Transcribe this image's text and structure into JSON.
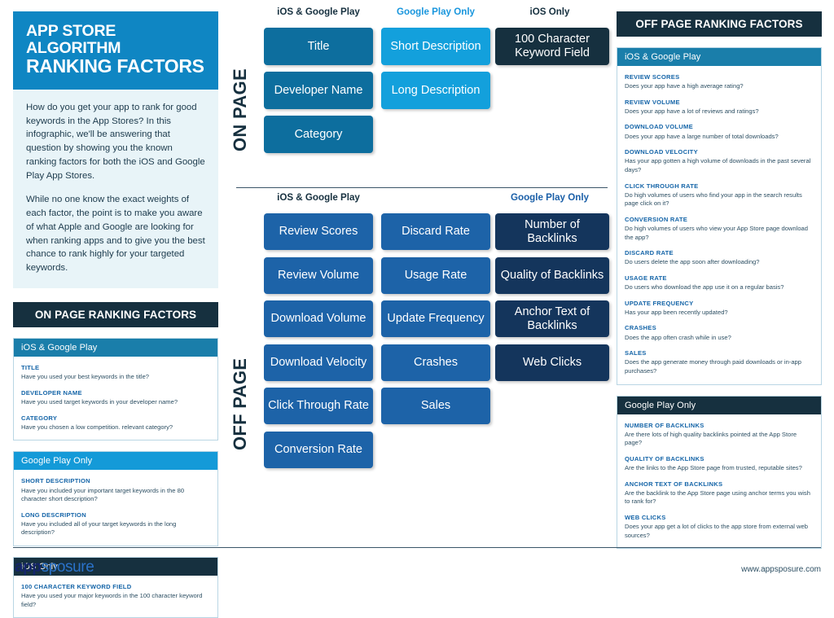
{
  "header": {
    "title_line1": "APP STORE ALGORITHM",
    "title_line2": "RANKING FACTORS",
    "intro_paragraph_1": "How do you get your app to rank for good keywords in the App Stores? In this infographic, we'll be answering that question by showing you the known ranking factors for both the iOS and Google Play App Stores.",
    "intro_paragraph_2": "While no one know the exact weights of each factor, the point is to make you aware of what Apple and Google are looking for when ranking apps and to give you the best chance to rank highly for your targeted keywords."
  },
  "on_page": {
    "section_label": "ON PAGE",
    "section_header": "ON PAGE RANKING FACTORS",
    "columns": [
      {
        "label": "iOS & Google Play",
        "color": "#16303f",
        "boxes": [
          "Title",
          "Developer Name",
          "Category"
        ]
      },
      {
        "label": "Google Play Only",
        "color": "#1996dd",
        "boxes": [
          "Short Description",
          "Long Description"
        ]
      },
      {
        "label": "iOS Only",
        "color": "#16303f",
        "boxes": [
          "100 Character Keyword Field"
        ]
      }
    ],
    "panels": [
      {
        "heading": "iOS & Google Play",
        "factors": [
          {
            "title": "TITLE",
            "desc": "Have you used your best keywords in the title?"
          },
          {
            "title": "DEVELOPER NAME",
            "desc": "Have you used target keywords in your developer name?"
          },
          {
            "title": "CATEGORY",
            "desc": "Have you chosen a low competition. relevant category?"
          }
        ]
      },
      {
        "heading": "Google Play Only",
        "factors": [
          {
            "title": "SHORT DESCRIPTION",
            "desc": "Have you included your important target keywords in the 80 character short description?"
          },
          {
            "title": "LONG DESCRIPTION",
            "desc": "Have you included all of your target keywords in the long description?"
          }
        ]
      },
      {
        "heading": "iOS Only",
        "factors": [
          {
            "title": "100 CHARACTER KEYWORD FIELD",
            "desc": "Have you used your major keywords in the 100 character keyword field?"
          }
        ]
      }
    ]
  },
  "off_page": {
    "section_label": "OFF PAGE",
    "section_header": "OFF PAGE RANKING FACTORS",
    "columns": [
      {
        "label": "iOS & Google Play",
        "color": "#16303f",
        "boxes": [
          "Review Scores",
          "Review Volume",
          "Download Volume",
          "Download Velocity",
          "Click Through Rate",
          "Conversion Rate"
        ]
      },
      {
        "label": "",
        "color": "#16303f",
        "boxes": [
          "Discard Rate",
          "Usage Rate",
          "Update Frequency",
          "Crashes",
          "Sales"
        ]
      },
      {
        "label": "Google Play Only",
        "color": "#1a5fa8",
        "boxes": [
          "Number of Backlinks",
          "Quality of Backlinks",
          "Anchor Text of Backlinks",
          "Web Clicks"
        ]
      }
    ],
    "panels": [
      {
        "heading": "iOS & Google Play",
        "factors": [
          {
            "title": "REVIEW SCORES",
            "desc": "Does your app have a high average rating?"
          },
          {
            "title": "REVIEW VOLUME",
            "desc": "Does your app have a lot of reviews and ratings?"
          },
          {
            "title": "DOWNLOAD VOLUME",
            "desc": "Does your app have a large number of total downloads?"
          },
          {
            "title": "DOWNLOAD VELOCITY",
            "desc": "Has your app gotten a high volume of downloads in the past several days?"
          },
          {
            "title": "CLICK THROUGH RATE",
            "desc": "Do high volumes of users who find your app in the search results page click on it?"
          },
          {
            "title": "CONVERSION RATE",
            "desc": "Do high volumes of users who view your App Store page download the app?"
          },
          {
            "title": "DISCARD RATE",
            "desc": "Do users delete the app soon after downloading?"
          },
          {
            "title": "USAGE RATE",
            "desc": "Do users who download the app use it on a regular basis?"
          },
          {
            "title": "UPDATE FREQUENCY",
            "desc": "Has your app been recently updated?"
          },
          {
            "title": "CRASHES",
            "desc": "Does the app often crash while in use?"
          },
          {
            "title": "SALES",
            "desc": "Does the app generate money through paid downloads or in-app purchases?"
          }
        ]
      },
      {
        "heading": "Google Play Only",
        "factors": [
          {
            "title": "NUMBER OF BACKLINKS",
            "desc": "Are there lots of high quality backlinks pointed at the App Store page?"
          },
          {
            "title": "QUALITY OF BACKLINKS",
            "desc": "Are the links to the App Store page from trusted, reputable sites?"
          },
          {
            "title": "ANCHOR TEXT OF BACKLINKS",
            "desc": "Are the backlink to the App Store page using anchor terms you wish to rank for?"
          },
          {
            "title": "WEB CLICKS",
            "desc": "Does your app get a lot of clicks to the app store from external web sources?"
          }
        ]
      }
    ]
  },
  "footer": {
    "logo_part1": "app",
    "logo_part2": "sposure",
    "url": "www.appsposure.com"
  }
}
